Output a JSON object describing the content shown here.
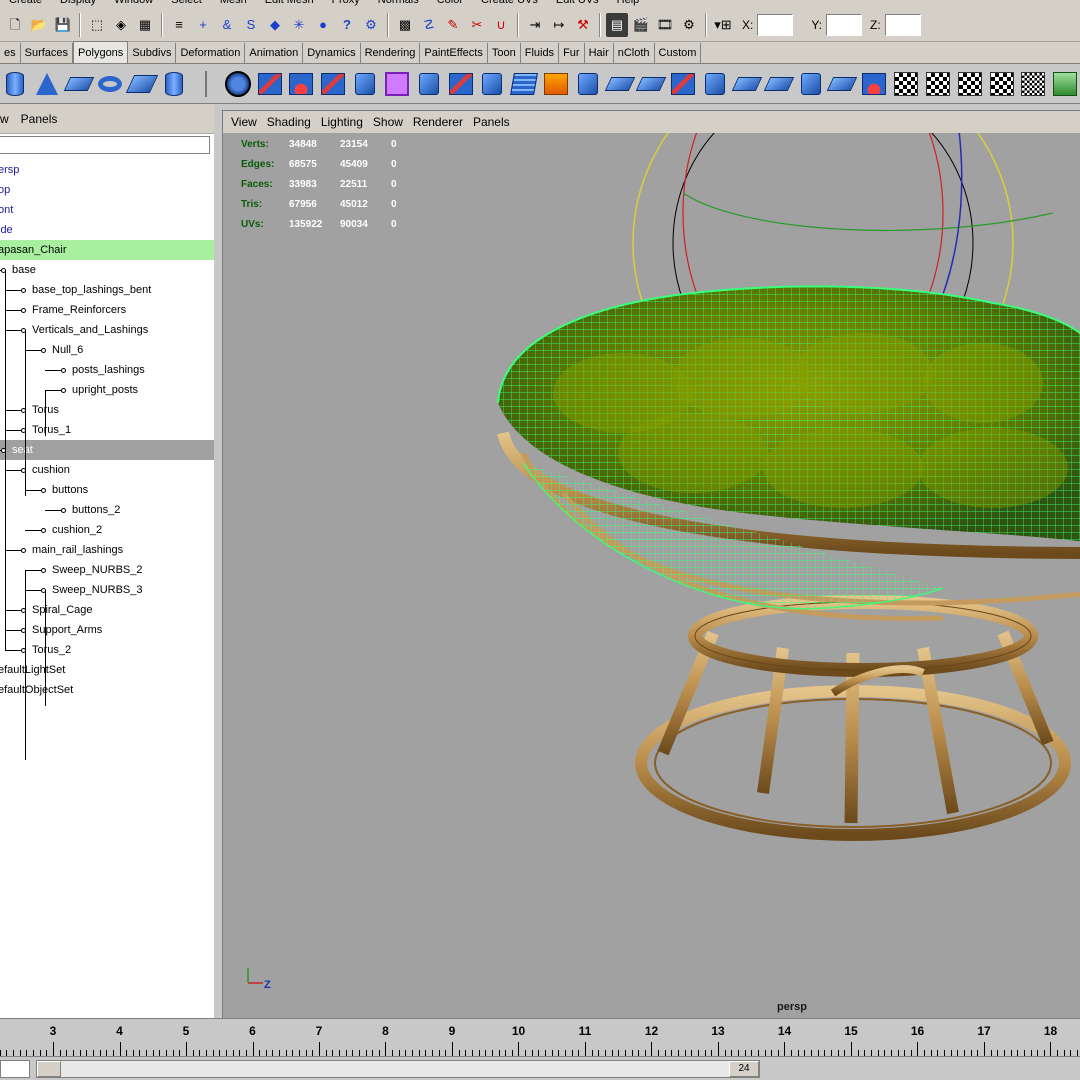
{
  "menubar": [
    "Create",
    "Display",
    "Window",
    "Select",
    "Mesh",
    "Edit Mesh",
    "Proxy",
    "Normals",
    "Color",
    "Create UVs",
    "Edit UVs",
    "Help"
  ],
  "coords": {
    "x_label": "X:",
    "y_label": "Y:",
    "z_label": "Z:"
  },
  "shelf_tabs": [
    "es",
    "Surfaces",
    "Polygons",
    "Subdivs",
    "Deformation",
    "Animation",
    "Dynamics",
    "Rendering",
    "PaintEffects",
    "Toon",
    "Fluids",
    "Fur",
    "Hair",
    "nCloth",
    "Custom"
  ],
  "active_shelf_tab": "Polygons",
  "outliner": {
    "menu": [
      "w",
      "Panels"
    ],
    "items": [
      {
        "label": "ersp"
      },
      {
        "label": "op"
      },
      {
        "label": "ont"
      },
      {
        "label": "ide"
      },
      {
        "label": "apasan_Chair"
      },
      {
        "label": "base"
      },
      {
        "label": "base_top_lashings_bent"
      },
      {
        "label": "Frame_Reinforcers"
      },
      {
        "label": "Verticals_and_Lashings"
      },
      {
        "label": "Null_6"
      },
      {
        "label": "posts_lashings"
      },
      {
        "label": "upright_posts"
      },
      {
        "label": "Torus"
      },
      {
        "label": "Torus_1"
      },
      {
        "label": "seat"
      },
      {
        "label": "cushion"
      },
      {
        "label": "buttons"
      },
      {
        "label": "buttons_2"
      },
      {
        "label": "cushion_2"
      },
      {
        "label": "main_rail_lashings"
      },
      {
        "label": "Sweep_NURBS_2"
      },
      {
        "label": "Sweep_NURBS_3"
      },
      {
        "label": "Spiral_Cage"
      },
      {
        "label": "Support_Arms"
      },
      {
        "label": "Torus_2"
      },
      {
        "label": "efaultLightSet"
      },
      {
        "label": "efaultObjectSet"
      }
    ]
  },
  "viewport": {
    "menu": [
      "View",
      "Shading",
      "Lighting",
      "Show",
      "Renderer",
      "Panels"
    ],
    "camera": "persp",
    "axis_z": "Z",
    "hud": [
      {
        "label": "Verts:",
        "v1": "34848",
        "v2": "23154",
        "v3": "0"
      },
      {
        "label": "Edges:",
        "v1": "68575",
        "v2": "45409",
        "v3": "0"
      },
      {
        "label": "Faces:",
        "v1": "33983",
        "v2": "22511",
        "v3": "0"
      },
      {
        "label": "Tris:",
        "v1": "67956",
        "v2": "45012",
        "v3": "0"
      },
      {
        "label": "UVs:",
        "v1": "135922",
        "v2": "90034",
        "v3": "0"
      }
    ]
  },
  "timeline": {
    "numbers": [
      "3",
      "4",
      "5",
      "6",
      "7",
      "8",
      "9",
      "10",
      "11",
      "12",
      "13",
      "14",
      "15",
      "16",
      "17",
      "18"
    ],
    "range_end": "24"
  }
}
